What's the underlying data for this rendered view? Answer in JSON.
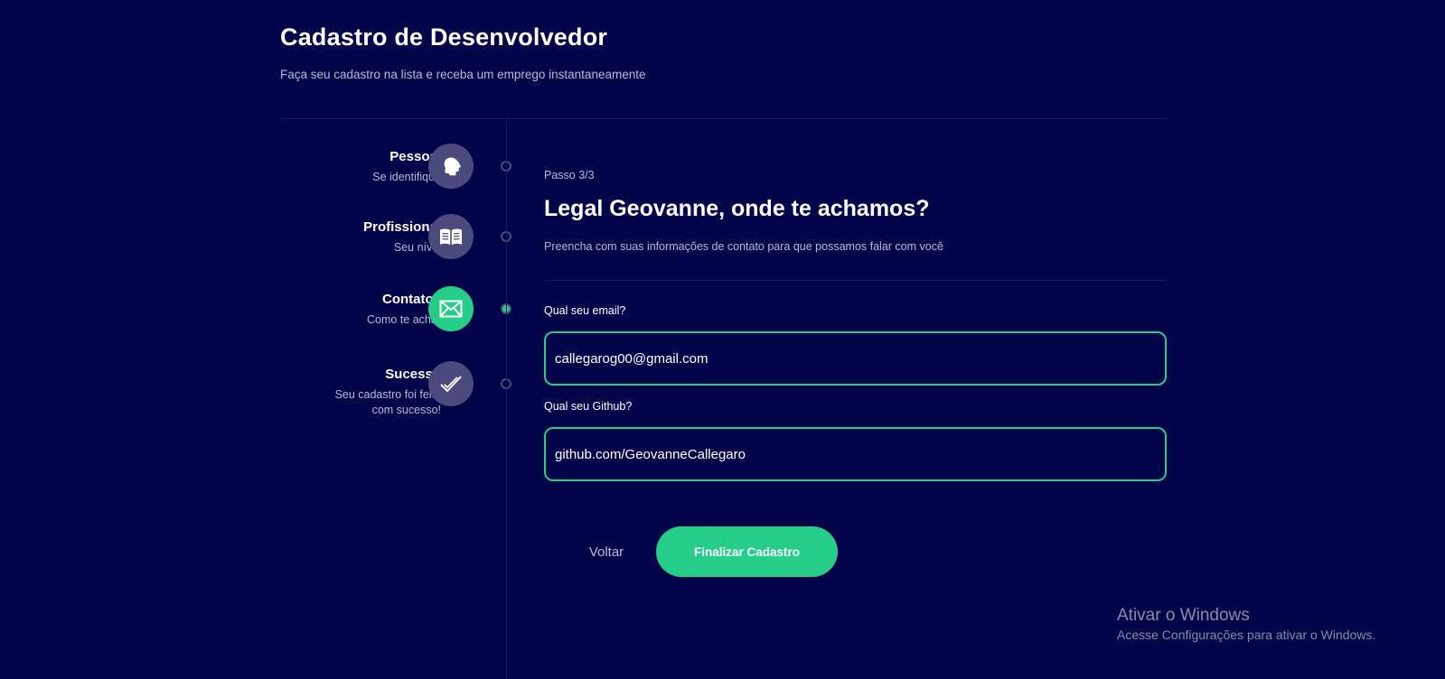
{
  "header": {
    "title": "Cadastro de Desenvolvedor",
    "subtitle": "Faça seu cadastro na lista e receba um emprego instantaneamente"
  },
  "sidebar": {
    "steps": [
      {
        "title": "Pessoal",
        "description": "Se identifique",
        "icon": "person-head-icon",
        "active": false
      },
      {
        "title": "Profissional",
        "description": "Seu nível",
        "icon": "book-icon",
        "active": false
      },
      {
        "title": "Contatos",
        "description": "Como te achar",
        "icon": "mail-icon",
        "active": true
      },
      {
        "title": "Sucesso",
        "description": "Seu cadastro foi feito com sucesso!",
        "icon": "check-icon",
        "active": false
      }
    ]
  },
  "main": {
    "step_counter": "Passo 3/3",
    "title": "Legal Geovanne, onde te achamos?",
    "description": "Preencha com suas informações de contato para que possamos falar com você",
    "fields": {
      "email": {
        "label": "Qual seu email?",
        "value": "callegarog00@gmail.com"
      },
      "github": {
        "label": "Qual seu Github?",
        "value": "github.com/GeovanneCallegaro"
      }
    },
    "buttons": {
      "back": "Voltar",
      "finish": "Finalizar Cadastro"
    }
  },
  "watermark": {
    "title": "Ativar o Windows",
    "subtitle": "Acesse Configurações para ativar o Windows."
  },
  "colors": {
    "background": "#02044a",
    "accent": "#25cd89",
    "inactive_icon": "#4a4a7c",
    "muted_text": "#b8b8d4"
  }
}
